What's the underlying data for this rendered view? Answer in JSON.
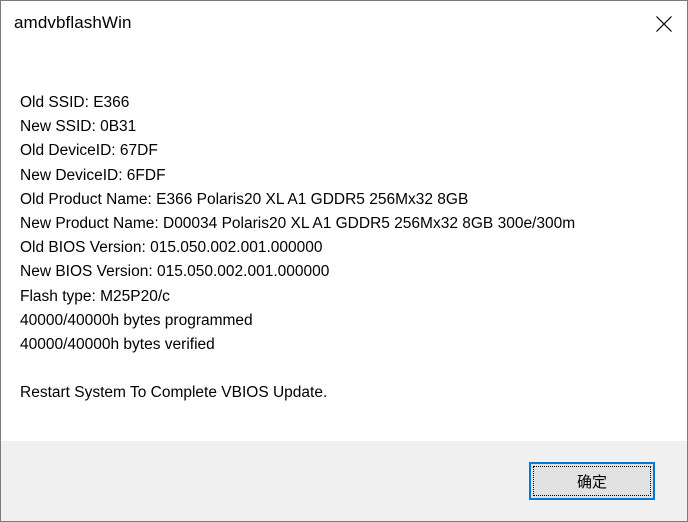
{
  "window": {
    "title": "amdvbflashWin"
  },
  "message": {
    "lines": [
      "Old SSID: E366",
      "New SSID: 0B31",
      "Old DeviceID: 67DF",
      "New DeviceID: 6FDF",
      "Old Product Name: E366 Polaris20 XL A1 GDDR5 256Mx32 8GB",
      "New Product Name: D00034 Polaris20 XL A1 GDDR5 256Mx32 8GB 300e/300m",
      "Old BIOS Version: 015.050.002.001.000000",
      "New BIOS Version: 015.050.002.001.000000",
      "Flash type: M25P20/c",
      "40000/40000h bytes programmed",
      "40000/40000h bytes verified"
    ],
    "footer_line": "Restart System To Complete VBIOS Update."
  },
  "buttons": {
    "ok_label": "确定"
  },
  "icons": {
    "close": "close-icon"
  },
  "colors": {
    "focus_border": "#0078d7",
    "footer_bg": "#f0f0f0",
    "button_bg": "#e1e1e1"
  }
}
